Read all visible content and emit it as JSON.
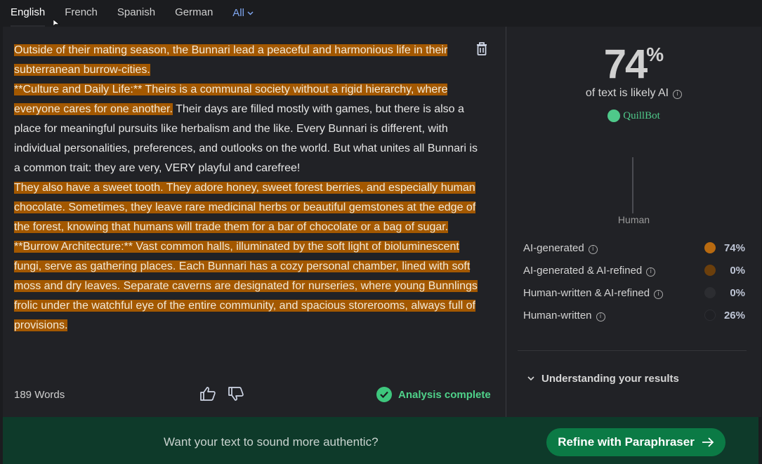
{
  "tabs": {
    "english": "English",
    "french": "French",
    "spanish": "Spanish",
    "german": "German",
    "all": "All"
  },
  "text": {
    "p1": "Outside of their mating season, the Bunnari lead a peaceful and harmonious life in their subterranean burrow-cities.",
    "p2a": "**Culture and Daily Life:** Theirs is a communal society without a rigid hierarchy, where everyone cares for one another.",
    "p2b": " Their days are filled mostly with games, but there is also a place for meaningful pursuits like herbalism and the like. Every Bunnari is different, with individual personalities, preferences, and outlooks on the world. But what unites all Bunnari is a common trait: they are very, VERY playful and carefree!",
    "p3": "They also have a sweet tooth. They adore honey, sweet forest berries, and especially human chocolate. Sometimes, they leave rare medicinal herbs or beautiful gemstones at the edge of the forest, knowing that humans will trade them for a bar of chocolate or a bag of sugar.",
    "p4": "**Burrow Architecture:** Vast common halls, illuminated by the soft light of bioluminescent fungi, serve as gathering places. Each Bunnari has a cozy personal chamber, lined with soft moss and dry leaves. Separate caverns are designated for nurseries, where young Bunnlings frolic under the watchful eye of the entire community, and spacious storerooms, always full of provisions."
  },
  "footer": {
    "word_count": "189 Words",
    "status": "Analysis complete"
  },
  "result": {
    "percent": "74",
    "percent_sign": "%",
    "likely_text": "of text is likely AI",
    "brand": "QuillBot",
    "gauge_label": "Human",
    "ai_fraction": 0.74
  },
  "legend": [
    {
      "label": "AI-generated",
      "value": "74%",
      "color": "#b86a10"
    },
    {
      "label": "AI-generated & AI-refined",
      "value": "0%",
      "color": "#6b3f0c"
    },
    {
      "label": "Human-written & AI-refined",
      "value": "0%",
      "color": "#2c2d31"
    },
    {
      "label": "Human-written",
      "value": "26%",
      "color": "#1f2024"
    }
  ],
  "understanding": "Understanding your results",
  "banner": {
    "text": "Want your text to sound more authentic?",
    "button": "Refine with Paraphraser"
  },
  "colors": {
    "highlight": "#a35800",
    "accent_green": "#4fd28a",
    "button_green": "#0b7a45",
    "banner_bg": "#0e3a2a"
  }
}
